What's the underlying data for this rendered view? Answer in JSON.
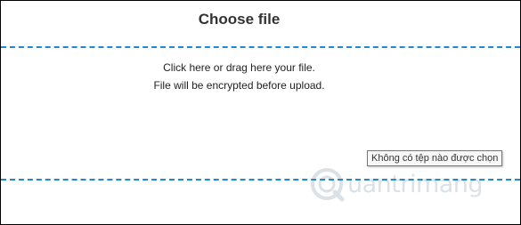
{
  "header": {
    "title": "Choose file"
  },
  "dropzone": {
    "line1": "Click here or drag here your file.",
    "line2": "File will be encrypted before upload."
  },
  "file_input": {
    "tooltip": "Không có tệp nào được chọn"
  },
  "watermark": {
    "text": "uantrimang"
  },
  "colors": {
    "dash": "#1e88d4",
    "title": "#333333",
    "text": "#222222"
  }
}
